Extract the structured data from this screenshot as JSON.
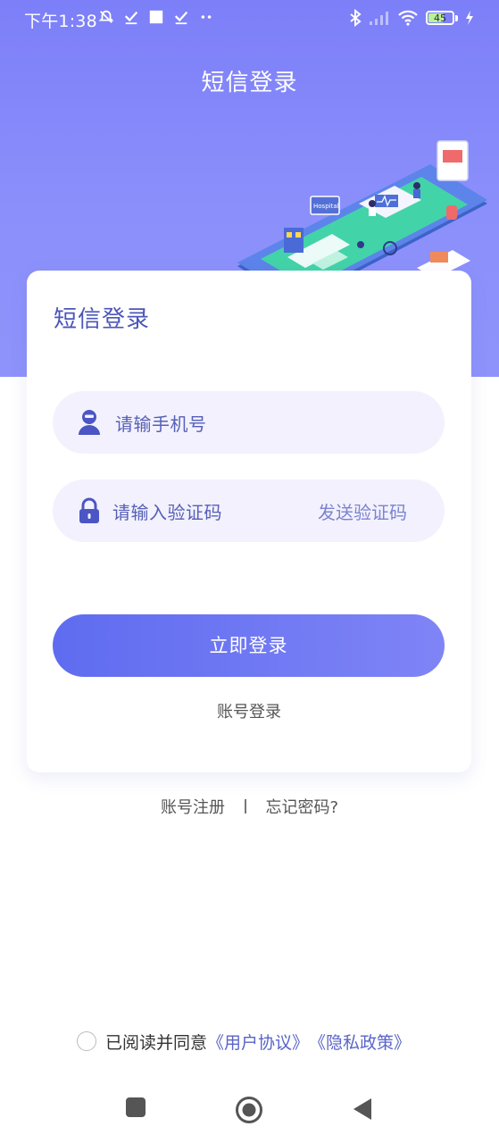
{
  "status_bar": {
    "time": "下午1:38",
    "battery_level": "45",
    "icons": [
      "mute-icon",
      "check-icon",
      "square-icon",
      "check-icon",
      "more-dots-icon",
      "bluetooth-icon",
      "signal-icon",
      "wifi-icon",
      "battery-icon",
      "charging-icon"
    ]
  },
  "header": {
    "title": "短信登录"
  },
  "card": {
    "title": "短信登录",
    "phone_placeholder": "请输手机号",
    "code_placeholder": "请输入验证码",
    "send_code_label": "发送验证码",
    "login_button": "立即登录",
    "alt_login": "账号登录"
  },
  "links": {
    "register": "账号注册",
    "forgot": "忘记密码?"
  },
  "agreement": {
    "prefix": "已阅读并同意",
    "user_agreement": "《用户协议》",
    "privacy_policy": "《隐私政策》",
    "checked": false
  },
  "nav": {
    "buttons": [
      "recent-apps-icon",
      "home-icon",
      "back-icon"
    ]
  },
  "colors": {
    "primary": "#6a74f2",
    "hero": "#8a8efb",
    "field_bg": "#f3f1fd",
    "link": "#5a64c8"
  }
}
